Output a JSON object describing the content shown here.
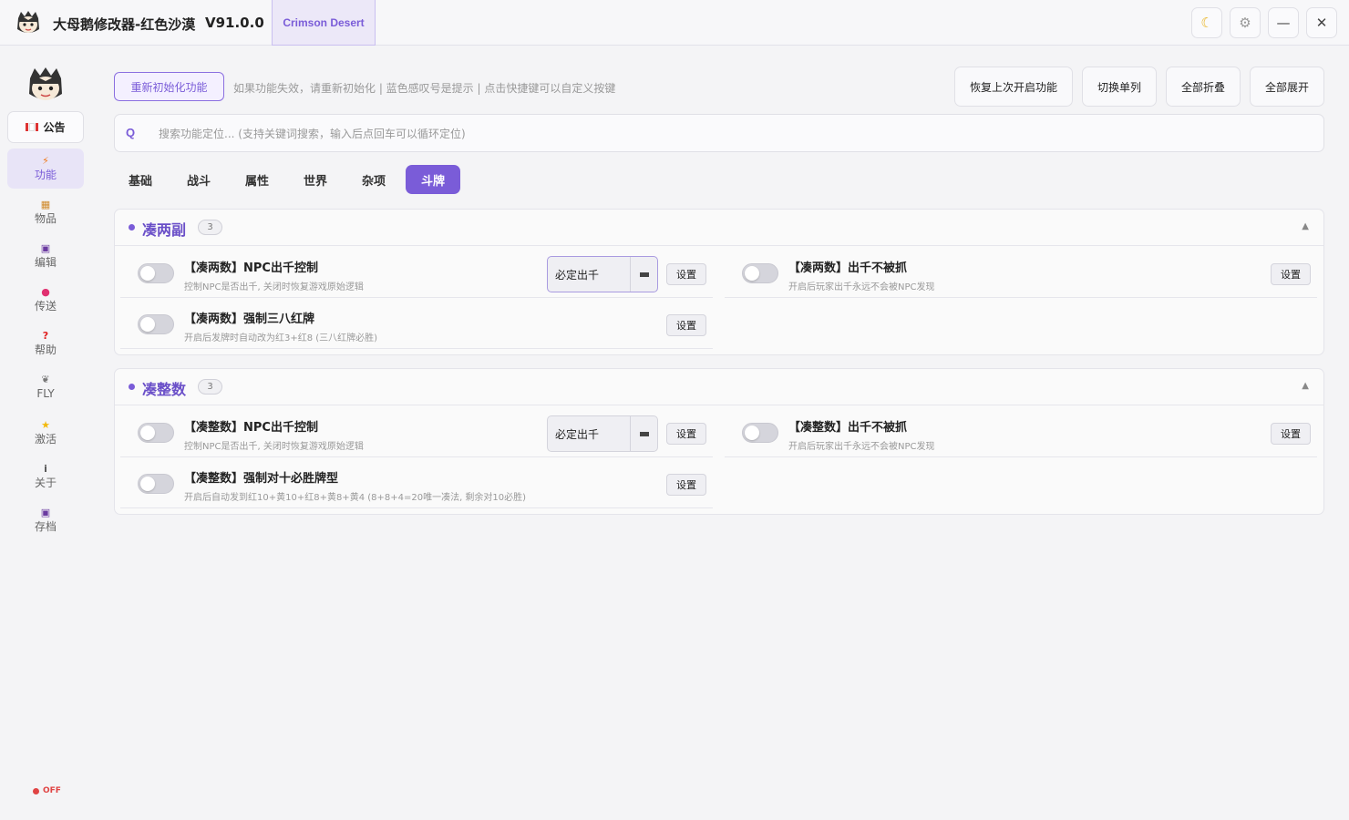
{
  "app": {
    "title": "大母鹅修改器-红色沙漠",
    "version": "V91.0.0",
    "game_tab": "Crimson Desert"
  },
  "window_controls": [
    "moon-icon",
    "gear-icon",
    "minimize-icon",
    "close-icon"
  ],
  "sidebar": {
    "notice_label": "公告",
    "items": [
      {
        "label": "功能",
        "icon": "lightning-icon",
        "active": true
      },
      {
        "label": "物品",
        "icon": "box-icon"
      },
      {
        "label": "编辑",
        "icon": "floppy-icon"
      },
      {
        "label": "传送",
        "icon": "pin-icon"
      },
      {
        "label": "帮助",
        "icon": "question-icon"
      },
      {
        "label": "FLY",
        "icon": "wing-icon"
      },
      {
        "label": "激活",
        "icon": "star-icon"
      },
      {
        "label": "关于",
        "icon": "info-icon"
      },
      {
        "label": "存档",
        "icon": "save-icon"
      }
    ],
    "status_text": "OFF"
  },
  "toolbar": {
    "reinit_label": "重新初始化功能",
    "hint": "如果功能失效，请重新初始化 | 蓝色感叹号是提示 | 点击快捷键可以自定义按键",
    "restore_label": "恢复上次开启功能",
    "single_col_label": "切换单列",
    "collapse_all_label": "全部折叠",
    "expand_all_label": "全部展开"
  },
  "search": {
    "icon_text": "Q",
    "placeholder": "搜索功能定位... (支持关键词搜索，输入后点回车可以循环定位)"
  },
  "tabs": [
    "基础",
    "战斗",
    "属性",
    "世界",
    "杂项",
    "斗牌"
  ],
  "active_tab": "斗牌",
  "sections": [
    {
      "title": "凑两副",
      "count": "3",
      "features": [
        {
          "title": "【凑两数】NPC出千控制",
          "desc": "控制NPC是否出千, 关闭时恢复游戏原始逻辑",
          "select": "必定出千",
          "set": "设置",
          "enabled": false
        },
        {
          "title": "【凑两数】出千不被抓",
          "desc": "开启后玩家出千永远不会被NPC发现",
          "set": "设置",
          "enabled": false
        },
        {
          "title": "【凑两数】强制三八红牌",
          "desc": "开启后发牌时自动改为红3+红8 (三八红牌必胜)",
          "set": "设置",
          "enabled": false
        }
      ]
    },
    {
      "title": "凑整数",
      "count": "3",
      "features": [
        {
          "title": "【凑整数】NPC出千控制",
          "desc": "控制NPC是否出千, 关闭时恢复游戏原始逻辑",
          "select": "必定出千",
          "set": "设置",
          "enabled": false
        },
        {
          "title": "【凑整数】出千不被抓",
          "desc": "开启后玩家出千永远不会被NPC发现",
          "set": "设置",
          "enabled": false
        },
        {
          "title": "【凑整数】强制对十必胜牌型",
          "desc": "开启后自动发到红10+黄10+红8+黄8+黄4 (8+8+4=20唯一凑法, 剩余对10必胜)",
          "set": "设置",
          "enabled": false
        }
      ]
    }
  ],
  "colors": {
    "accent": "#7a5cd8",
    "status_off": "#e04444"
  }
}
